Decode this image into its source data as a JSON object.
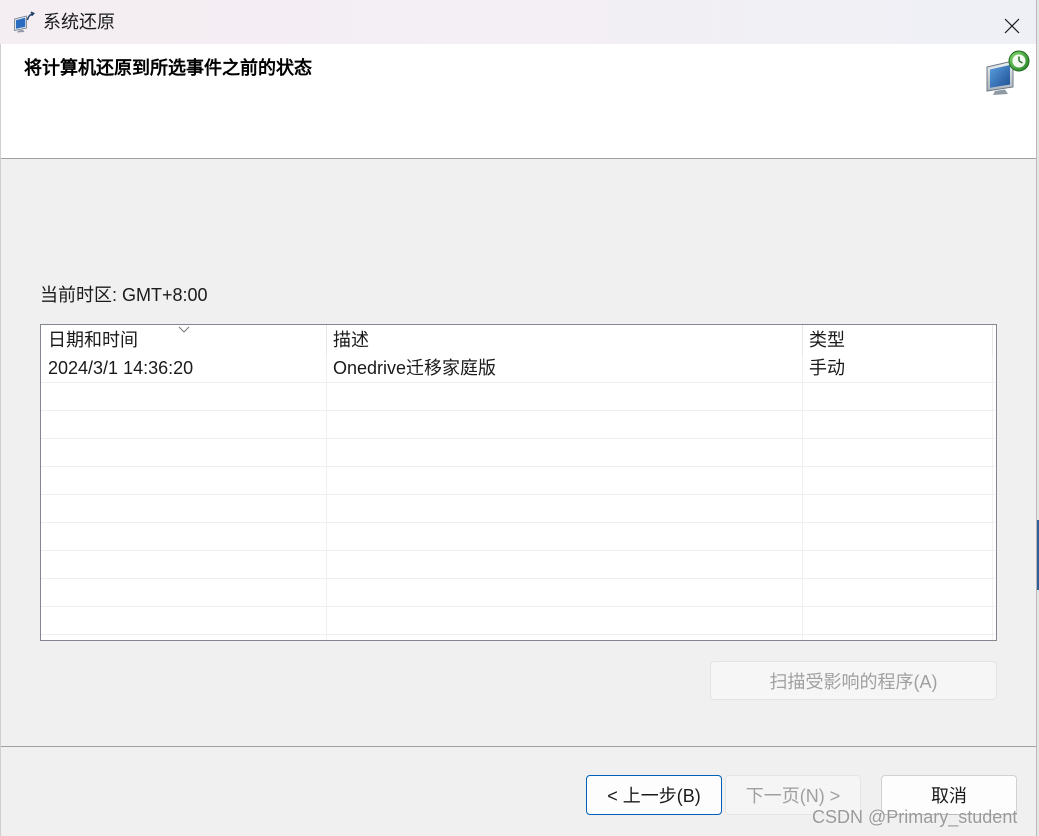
{
  "window": {
    "title": "系统还原",
    "title_icon": "system-restore-icon",
    "close_icon": "close-icon"
  },
  "header": {
    "title": "将计算机还原到所选事件之前的状态",
    "icon": "system-restore-icon"
  },
  "timezone": {
    "label": "当前时区: GMT+8:00"
  },
  "restore_points": {
    "sort_icon": "chevron-down-icon",
    "columns": [
      "日期和时间",
      "描述",
      "类型"
    ],
    "rows": [
      {
        "datetime": "2024/3/1 14:36:20",
        "description": "Onedrive迁移家庭版",
        "type": "手动"
      }
    ]
  },
  "actions": {
    "scan_label": "扫描受影响的程序(A)",
    "scan_enabled": false
  },
  "footer": {
    "back_label": "< 上一步(B)",
    "next_label": "下一页(N) >",
    "next_enabled": false,
    "cancel_label": "取消"
  },
  "watermark": "CSDN @Primary_student",
  "colors": {
    "title_bar": "#f4eef3",
    "title_bar_end": "#eef0f6",
    "body_bg": "#f0f0f0",
    "focus_border": "#005fb8",
    "disabled_text": "#a0a0a0"
  }
}
